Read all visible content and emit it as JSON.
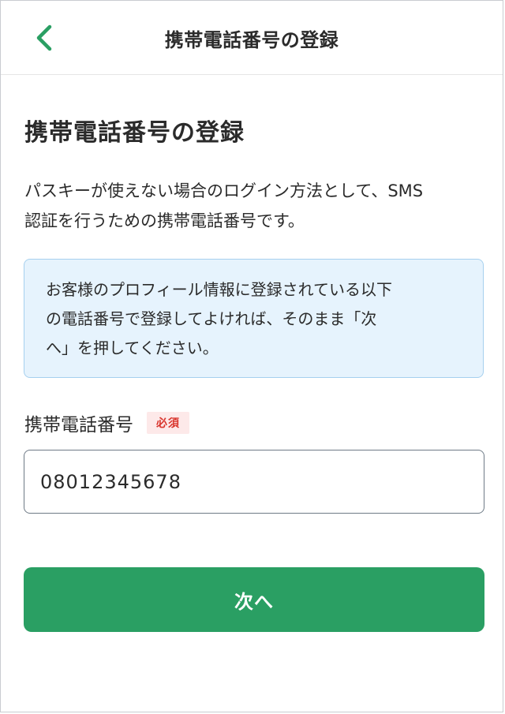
{
  "header": {
    "back_icon": "chevron-left-icon",
    "title": "携帯電話番号の登録"
  },
  "main": {
    "heading": "携帯電話番号の登録",
    "description_lines": [
      "パスキーが使えない場合のログイン方法として、SMS",
      "認証を行うための携帯電話番号です。"
    ],
    "notice_lines": [
      "お客様のプロフィール情報に登録されている以下",
      "の電話番号で登録してよければ、そのまま「次",
      "へ」を押してください。"
    ],
    "phone_field": {
      "label": "携帯電話番号",
      "required_badge": "必須",
      "value": "08012345678"
    },
    "next_button_label": "次へ"
  },
  "colors": {
    "accent_green": "#2a9f63",
    "notice_bg": "#e6f3fd",
    "notice_border": "#a6d0ef",
    "required_text": "#d9352d",
    "required_bg": "#fde9e9"
  }
}
